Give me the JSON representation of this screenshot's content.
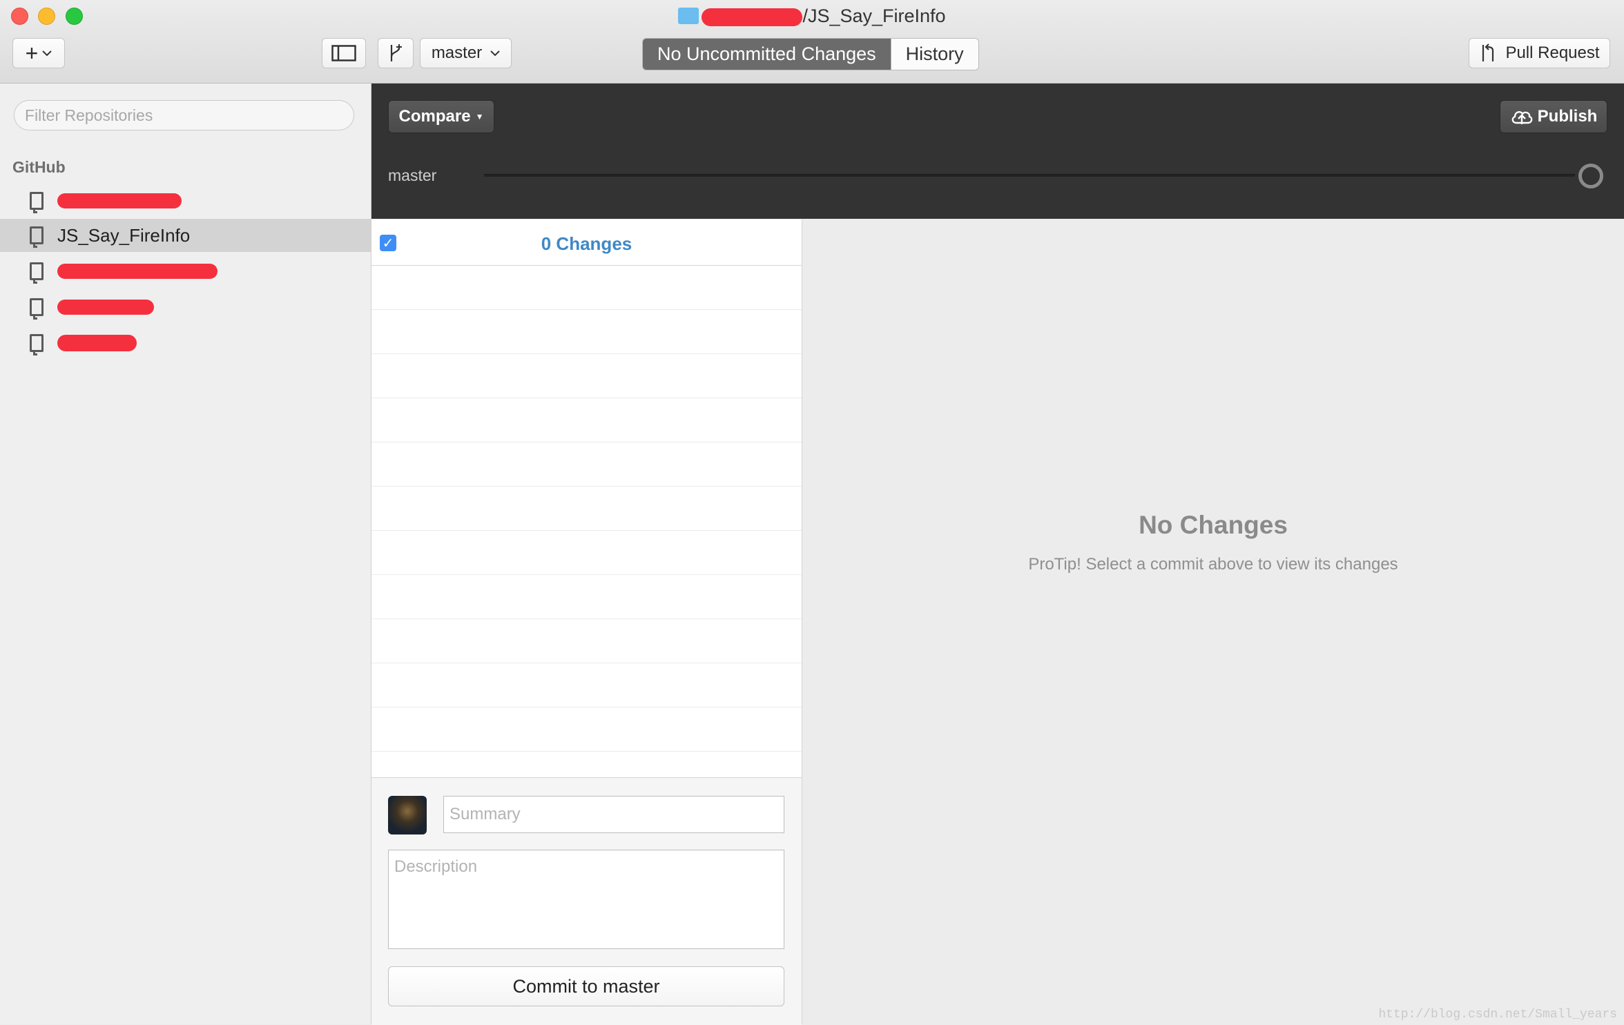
{
  "window": {
    "title_suffix": "/JS_Say_FireInfo",
    "folder_icon": "folder-icon"
  },
  "toolbar": {
    "add_icon": "plus-icon",
    "branch_selector": "master",
    "segments": [
      {
        "label": "No Uncommitted Changes",
        "active": true
      },
      {
        "label": "History",
        "active": false
      }
    ],
    "pull_request_label": "Pull Request"
  },
  "sidebar": {
    "filter_placeholder": "Filter Repositories",
    "section_title": "GitHub",
    "repos": [
      {
        "name": "",
        "redacted": true
      },
      {
        "name": "JS_Say_FireInfo",
        "selected": true
      },
      {
        "name": "",
        "redacted": true
      },
      {
        "name": "",
        "redacted": true
      },
      {
        "name": "",
        "redacted": true
      }
    ]
  },
  "header": {
    "compare_label": "Compare",
    "publish_label": "Publish",
    "branch_label": "master"
  },
  "changes": {
    "count_label": "0 Changes",
    "summary_placeholder": "Summary",
    "description_placeholder": "Description",
    "commit_button": "Commit to master"
  },
  "diff": {
    "empty_title": "No Changes",
    "empty_tip": "ProTip! Select a commit above to view its changes"
  },
  "watermark": "http://blog.csdn.net/Small_years",
  "colors": {
    "accent": "#3f88c6",
    "redaction": "#f4303f",
    "dark_header": "#333333"
  }
}
